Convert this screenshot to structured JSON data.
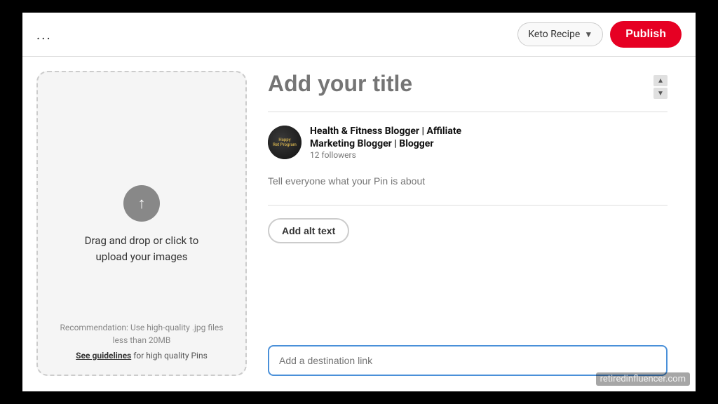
{
  "topBar": {
    "dots": "...",
    "boardSelect": {
      "label": "Keto Recipe",
      "chevron": "▼"
    },
    "publishButton": "Publish"
  },
  "uploadArea": {
    "uploadIcon": "↑",
    "uploadText": "Drag and drop or click to\nupload your images",
    "recommendation": "Recommendation: Use high-quality .jpg files\nless than 20MB",
    "guidelinesPrefix": "",
    "guidelinesLink": "See guidelines",
    "guidelinesSuffix": " for high quality Pins"
  },
  "rightPanel": {
    "titlePlaceholder": "Add your title",
    "scrollUp": "▲",
    "scrollDown": "▼",
    "profile": {
      "name": "Health & Fitness Blogger | Affiliate\nMarketing Blogger | Blogger",
      "followers": "12 followers",
      "avatarText": "Happy\nRet Program"
    },
    "descriptionPlaceholder": "Tell everyone what your Pin is about",
    "altTextButton": "Add alt text",
    "destinationPlaceholder": "Add a destination link"
  },
  "watermark": "retiredinfluencer.com"
}
